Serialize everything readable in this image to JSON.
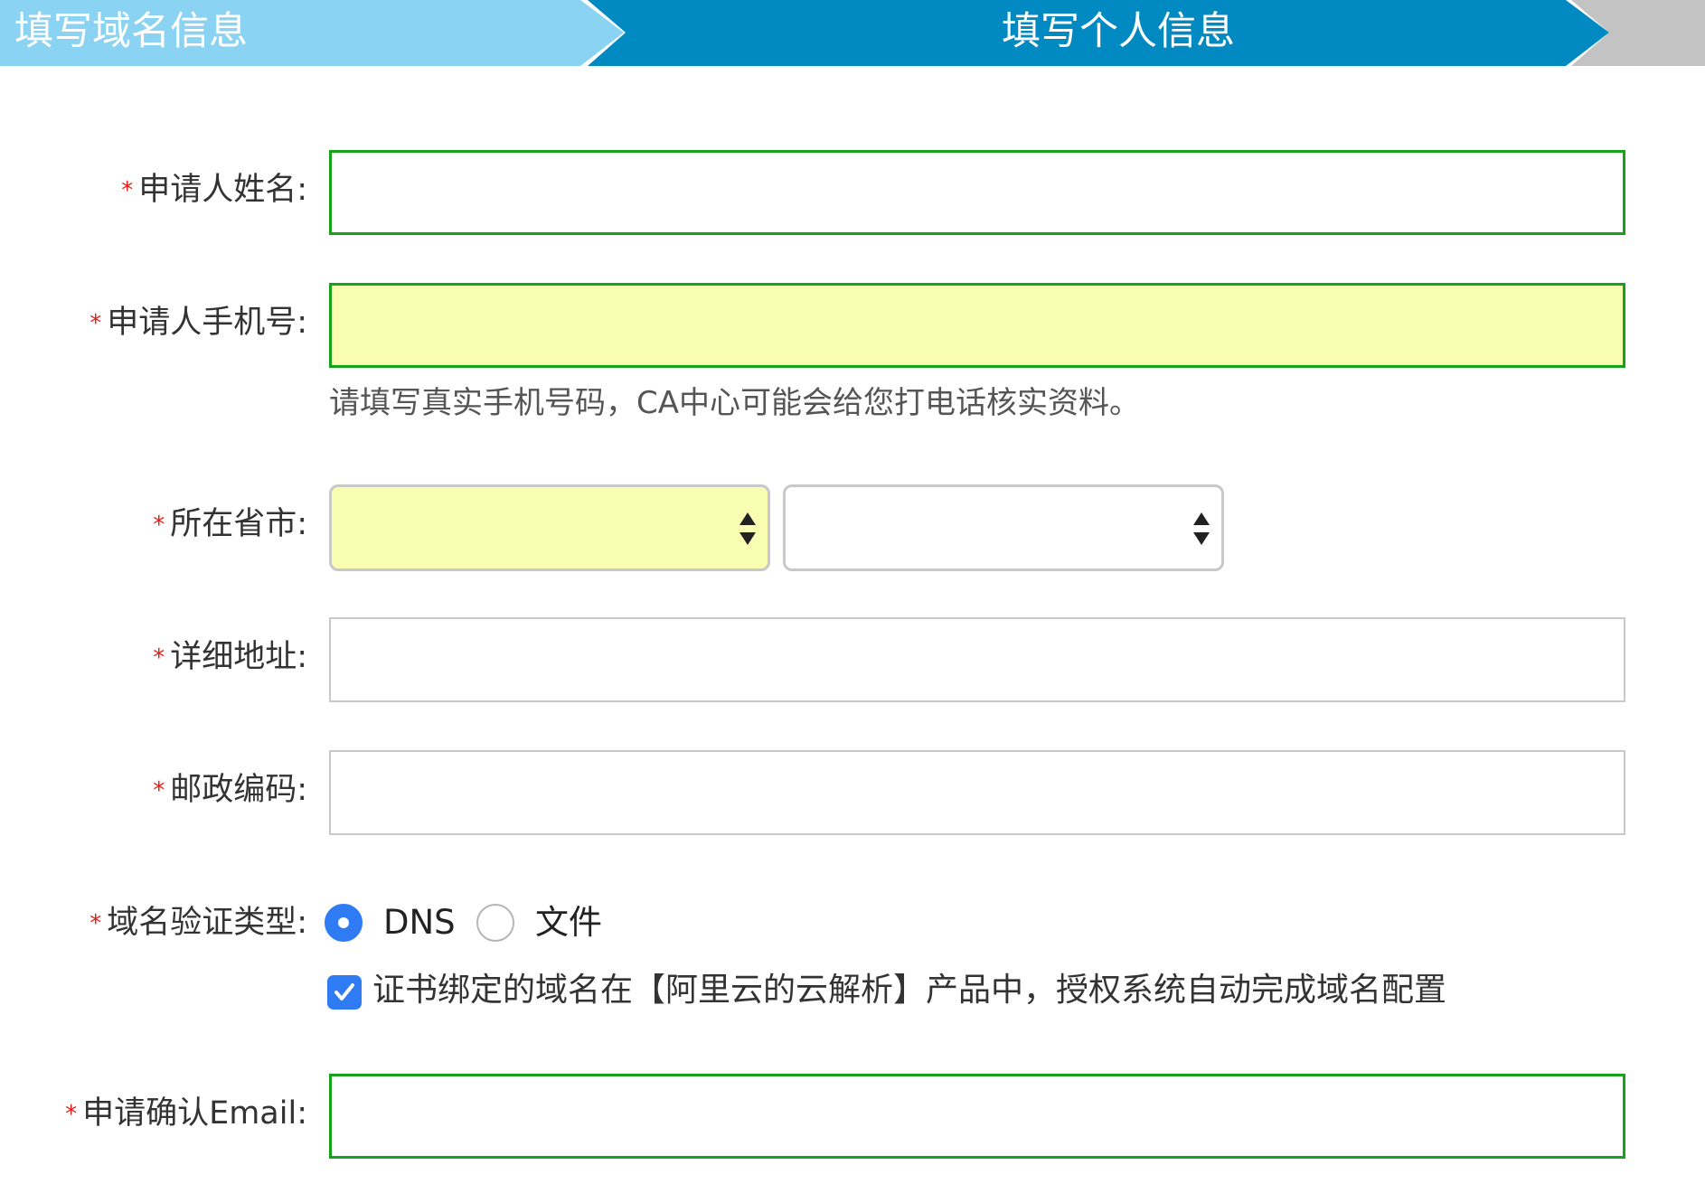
{
  "steps": [
    {
      "label": "填写域名信息",
      "state": "done"
    },
    {
      "label": "填写个人信息",
      "state": "active"
    },
    {
      "label": "",
      "state": "pending"
    }
  ],
  "form": {
    "required_mark": "*",
    "name": {
      "label": "申请人姓名:",
      "value": ""
    },
    "phone": {
      "label": "申请人手机号:",
      "value": "",
      "hint": "请填写真实手机号码，CA中心可能会给您打电话核实资料。"
    },
    "region": {
      "label": "所在省市:",
      "province": "",
      "city": ""
    },
    "address": {
      "label": "详细地址:",
      "value": ""
    },
    "postcode": {
      "label": "邮政编码:",
      "value": ""
    },
    "verify_type": {
      "label": "域名验证类型:",
      "options": [
        {
          "label": "DNS",
          "selected": true
        },
        {
          "label": "文件",
          "selected": false
        }
      ]
    },
    "auto_config": {
      "checked": true,
      "label": "证书绑定的域名在【阿里云的云解析】产品中，授权系统自动完成域名配置"
    },
    "email": {
      "label": "申请确认Email:",
      "value": ""
    }
  },
  "colors": {
    "step_done": "#8bd3f2",
    "step_active": "#018ac2",
    "step_pending": "#c3c3c3",
    "valid_border": "#17a21b",
    "autofill_bg": "#f8fdb2",
    "required": "#e61f18",
    "accent": "#2e7bf4"
  }
}
